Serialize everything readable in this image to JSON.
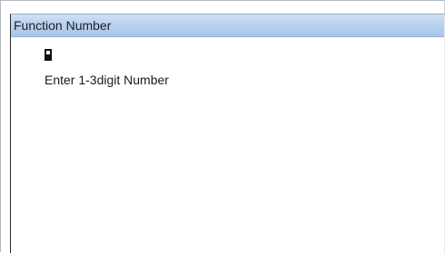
{
  "window": {
    "title": "Function Number"
  },
  "content": {
    "input_value": "",
    "prompt": "Enter 1-3digit Number"
  },
  "colors": {
    "title_bar_top": "#cfe1f4",
    "title_bar_bottom": "#a7c6ea",
    "background": "#ffffff",
    "text": "#1a1a1a"
  },
  "icons": {
    "cursor": "text-cursor-icon"
  }
}
